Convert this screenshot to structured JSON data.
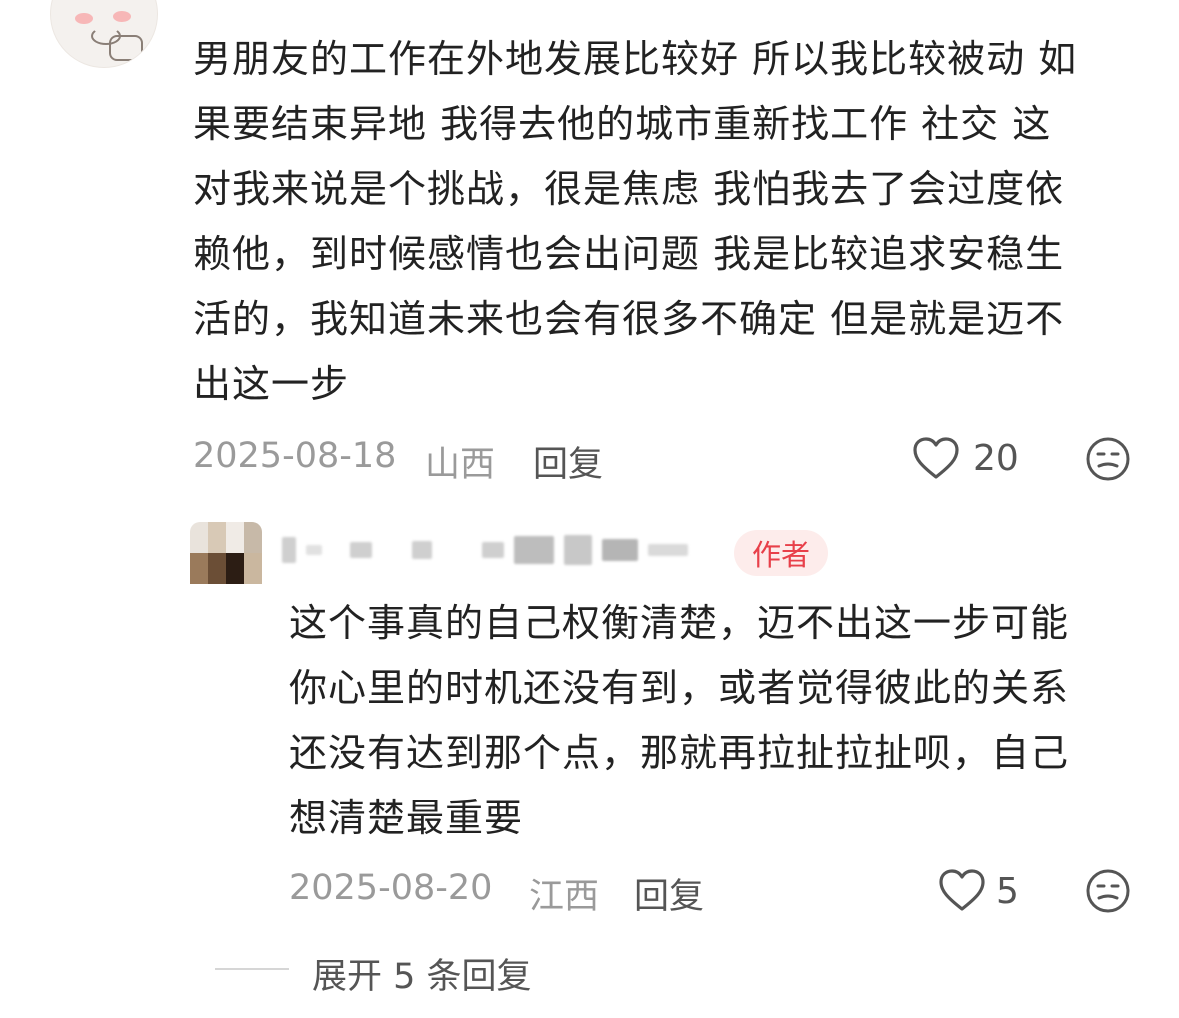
{
  "comment": {
    "lines": [
      "男朋友的工作在外地发展比较好 所以我比较被动 如",
      "果要结束异地 我得去他的城市重新找工作 社交 这",
      "对我来说是个挑战，很是焦虑 我怕我去了会过度依",
      "赖他，到时候感情也会出问题 我是比较追求安稳生",
      "活的，我知道未来也会有很多不确定 但是就是迈不",
      "出这一步"
    ],
    "date": "2025-08-18",
    "location": "山西",
    "reply_label": "回复",
    "likes": "20"
  },
  "reply": {
    "author_badge": "作者",
    "lines": [
      "这个事真的自己权衡清楚，迈不出这一步可能",
      "你心里的时机还没有到，或者觉得彼此的关系",
      "还没有达到那个点，那就再拉扯拉扯呗，自己",
      "想清楚最重要"
    ],
    "date": "2025-08-20",
    "location": "江西",
    "reply_label": "回复",
    "likes": "5"
  },
  "expand": {
    "label": "展开 5 条回复"
  },
  "icons": {
    "like": "heart-outline-icon",
    "dislike": "meh-face-icon"
  },
  "colors": {
    "author_badge_bg": "#fdeceb",
    "author_badge_text": "#e8404a"
  }
}
